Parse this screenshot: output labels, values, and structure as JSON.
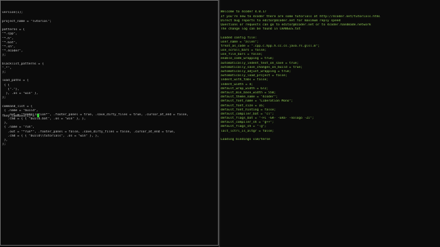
{
  "colors": {
    "background": "#0b0b0b",
    "left_text": "#c8c8c8",
    "right_text": "#8fcb52",
    "cursor": "#33cc33",
    "panel_border": "#6a6a6a"
  },
  "left_panel": {
    "lines": [
      "version(1);",
      "",
      "project_name = \"Tutorial\";",
      "",
      "patterns = {",
      "\"*.cpp\",",
      "\"*.h\",",
      "\"*.bat\",",
      "\"*.sh\",",
      "\"*.4coder\",",
      "};",
      "",
      "blacklist_patterns = {",
      "\".*\",",
      "};",
      "",
      "load_paths = {",
      " { {",
      "   {\".\"},",
      "  }, .os = \"win\" },",
      "};",
      "",
      "command_list = {",
      " { .name = \"build\",",
      "   .out = \"*compilation*\", .footer_panel = true, .save_dirty_files = true, .cursor_at_end = false,",
      "   .cmd = { { \"build.bat\", .os = \"win\" }, },",
      " },",
      " { .name = \"run\",",
      "   .out = \"*run*\", .footer_panel = false, .save_dirty_files = false, .cursor_at_end = true,",
      "   .cmd = { { \"build\\\\tutorials\", .os = \"win\" }, },",
      " },",
      "};"
    ],
    "footer_text": "fkey_command[1] = "
  },
  "right_panel": {
    "lines": [
      "Welcome to 4coder 4.0.17",
      "If you're new to 4coder there are some tutorials at http://4coder.net/tutorials.html",
      "Direct bug reports to editor@4coder.net for maximum reply speed",
      "Questions or requests can go to editor@4coder.net or to 4coder.handmade.network",
      "The change log can be found in CHANGES.txt",
      "",
      "Loaded config file:",
      "user_name = \"allen\";",
      "treat_as_code = \".cpp.c.hpp.h.cc.cs.java.rs.glsl.m\";",
      "use_scroll_bars = false;",
      "use_file_bars = false;",
      "enable_code_wrapping = true;",
      "automatically_indent_text_on_save = true;",
      "automatically_save_changes_on_build = true;",
      "automatically_adjust_wrapping = true;",
      "automatically_load_project = false;",
      "indent_with_tabs = false;",
      "indent_width = 4;",
      "default_wrap_width = 672;",
      "default_min_base_width = 550;",
      "default_theme_name = \"4coder\";",
      "default_font_name = \"Liberation Mono\";",
      "default_font_size = 16;",
      "default_font_hinting = false;",
      "default_compiler_bat = \"cl\";",
      "default_flags_bat = \"-FC -GR- -EHa- -nologo -Zi\";",
      "default_compiler_sh = \"g++\";",
      "default_flags_sh = \"-g\";",
      "lalt_lctrl_is_altgr = false;",
      "",
      "Loading bindings vim/terse"
    ]
  }
}
